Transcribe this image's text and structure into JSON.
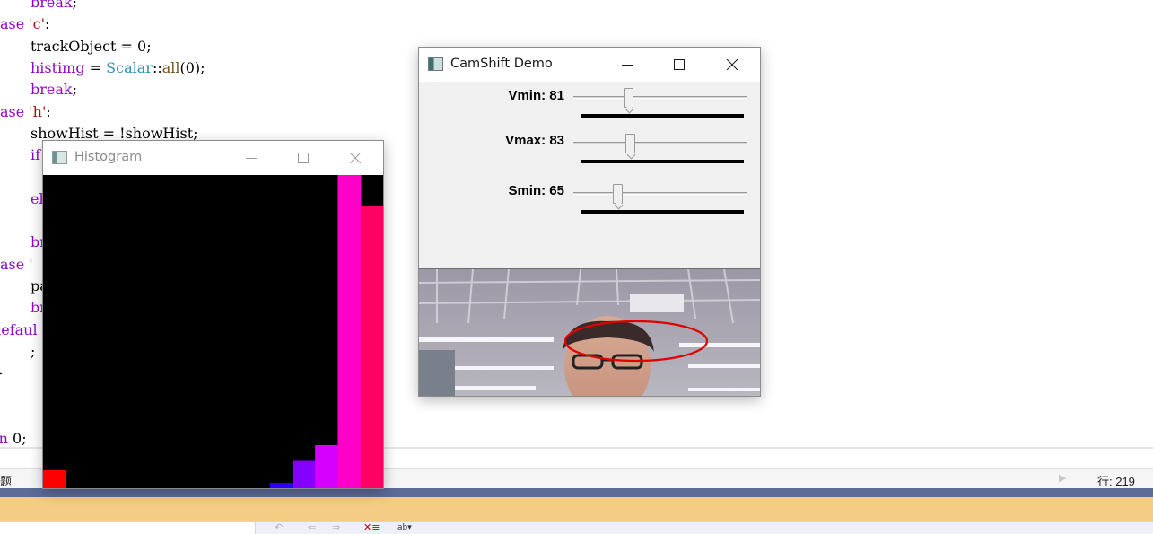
{
  "editor": {
    "lines": [
      {
        "indent": "    ",
        "parts": [
          [
            "kw",
            "break"
          ],
          [
            "",
            ";"
          ]
        ]
      },
      {
        "indent": "",
        "parts": [
          [
            "kw",
            "case"
          ],
          [
            "",
            " "
          ],
          [
            "str",
            "'c'"
          ],
          [
            "",
            ":"
          ]
        ]
      },
      {
        "indent": "    ",
        "parts": [
          [
            "",
            "trackObject = 0;"
          ]
        ]
      },
      {
        "indent": "    ",
        "parts": [
          [
            "kw",
            "histimg"
          ],
          [
            "",
            " = "
          ],
          [
            "ty",
            "Scalar"
          ],
          [
            "",
            "::"
          ],
          [
            "fn",
            "all"
          ],
          [
            "",
            "(0);"
          ]
        ]
      },
      {
        "indent": "    ",
        "parts": [
          [
            "kw",
            "break"
          ],
          [
            "",
            ";"
          ]
        ]
      },
      {
        "indent": "",
        "parts": [
          [
            "kw",
            "case"
          ],
          [
            "",
            " "
          ],
          [
            "str",
            "'h'"
          ],
          [
            "",
            ":"
          ]
        ]
      },
      {
        "indent": "    ",
        "parts": [
          [
            "",
            "showHist = !showHist;"
          ]
        ]
      },
      {
        "indent": "    ",
        "parts": [
          [
            "kw",
            "if"
          ]
        ]
      },
      {
        "indent": "",
        "parts": []
      },
      {
        "indent": "    ",
        "parts": [
          [
            "kw",
            "el"
          ]
        ]
      },
      {
        "indent": "",
        "parts": []
      },
      {
        "indent": "    ",
        "parts": [
          [
            "kw",
            "br"
          ]
        ]
      },
      {
        "indent": "",
        "parts": [
          [
            "kw",
            "case"
          ],
          [
            "",
            " "
          ],
          [
            "str",
            "'"
          ]
        ]
      },
      {
        "indent": "    ",
        "parts": [
          [
            "",
            "pa"
          ]
        ]
      },
      {
        "indent": "    ",
        "parts": [
          [
            "kw",
            "br"
          ]
        ]
      },
      {
        "indent": "",
        "parts": [
          [
            "kw",
            "defaul"
          ]
        ]
      },
      {
        "indent": "    ",
        "parts": [
          [
            "",
            ";"
          ]
        ]
      },
      {
        "indent": "",
        "parts": [
          [
            "",
            "}"
          ]
        ]
      },
      {
        "indent": "",
        "parts": []
      },
      {
        "indent": "",
        "parts": []
      },
      {
        "indent": "",
        "parts": [
          [
            "kw",
            "rn"
          ],
          [
            "",
            " 0;"
          ]
        ]
      }
    ]
  },
  "status_bar": {
    "left_text": "题",
    "line_indicator": "行: 219"
  },
  "toolbar": {
    "icons": [
      "↶",
      "⇐",
      "⇒",
      "✕≡",
      "ab▾"
    ]
  },
  "histogram_window": {
    "title": "Histogram",
    "colors": {
      "bar_red": "#ff0000",
      "bar_blue": "#2a00ff",
      "bar_violet": "#8400ff",
      "bar_purple": "#d600ff",
      "bar_magenta": "#ff00c8",
      "bar_pinkred": "#ff0064"
    },
    "bins": [
      0.06,
      0,
      0,
      0,
      0,
      0,
      0,
      0,
      0,
      0,
      0.02,
      0.09,
      0.14,
      1.0,
      0.9
    ],
    "bin_colors": [
      "#ff0000",
      "#000000",
      "#000000",
      "#000000",
      "#000000",
      "#000000",
      "#000000",
      "#000000",
      "#000000",
      "#000000",
      "#2a00ff",
      "#8400ff",
      "#d600ff",
      "#ff00c8",
      "#ff0064"
    ]
  },
  "camshift_window": {
    "title": "CamShift Demo",
    "trackbars": [
      {
        "label": "Vmin: 81",
        "value": 81,
        "max": 256
      },
      {
        "label": "Vmax: 83",
        "value": 83,
        "max": 256
      },
      {
        "label": "Smin: 65",
        "value": 65,
        "max": 256
      }
    ],
    "tracking_ellipse_color": "#e00000"
  }
}
